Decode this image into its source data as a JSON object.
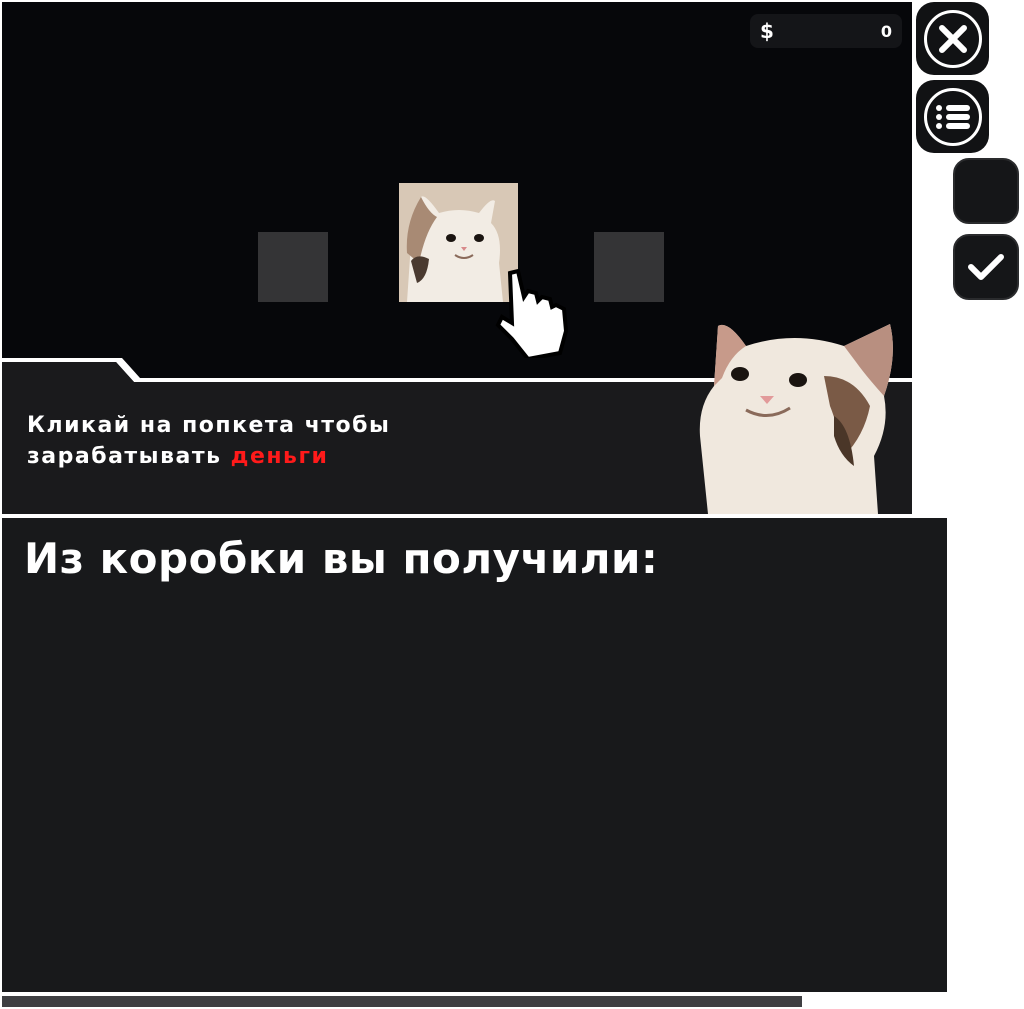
{
  "hud": {
    "money_icon": "dollar-icon",
    "money_symbol": "$",
    "money_value": "0"
  },
  "hint": {
    "line1": "Кликай на попкета чтобы",
    "line2_prefix": "зарабатывать ",
    "line2_accent": "деньги",
    "accent_color": "#ff1a1a"
  },
  "buttons": {
    "close_icon": "close-icon",
    "menu_icon": "list-menu-icon",
    "check_icon": "check-icon"
  },
  "reward": {
    "title": "Из коробки вы получили:"
  },
  "progress": {
    "fraction": 1.0
  },
  "colors": {
    "game_bg": "#06070a",
    "panel_bg": "#18191b",
    "slot_bg": "#343436",
    "progress_fill": "#3f3f42"
  }
}
